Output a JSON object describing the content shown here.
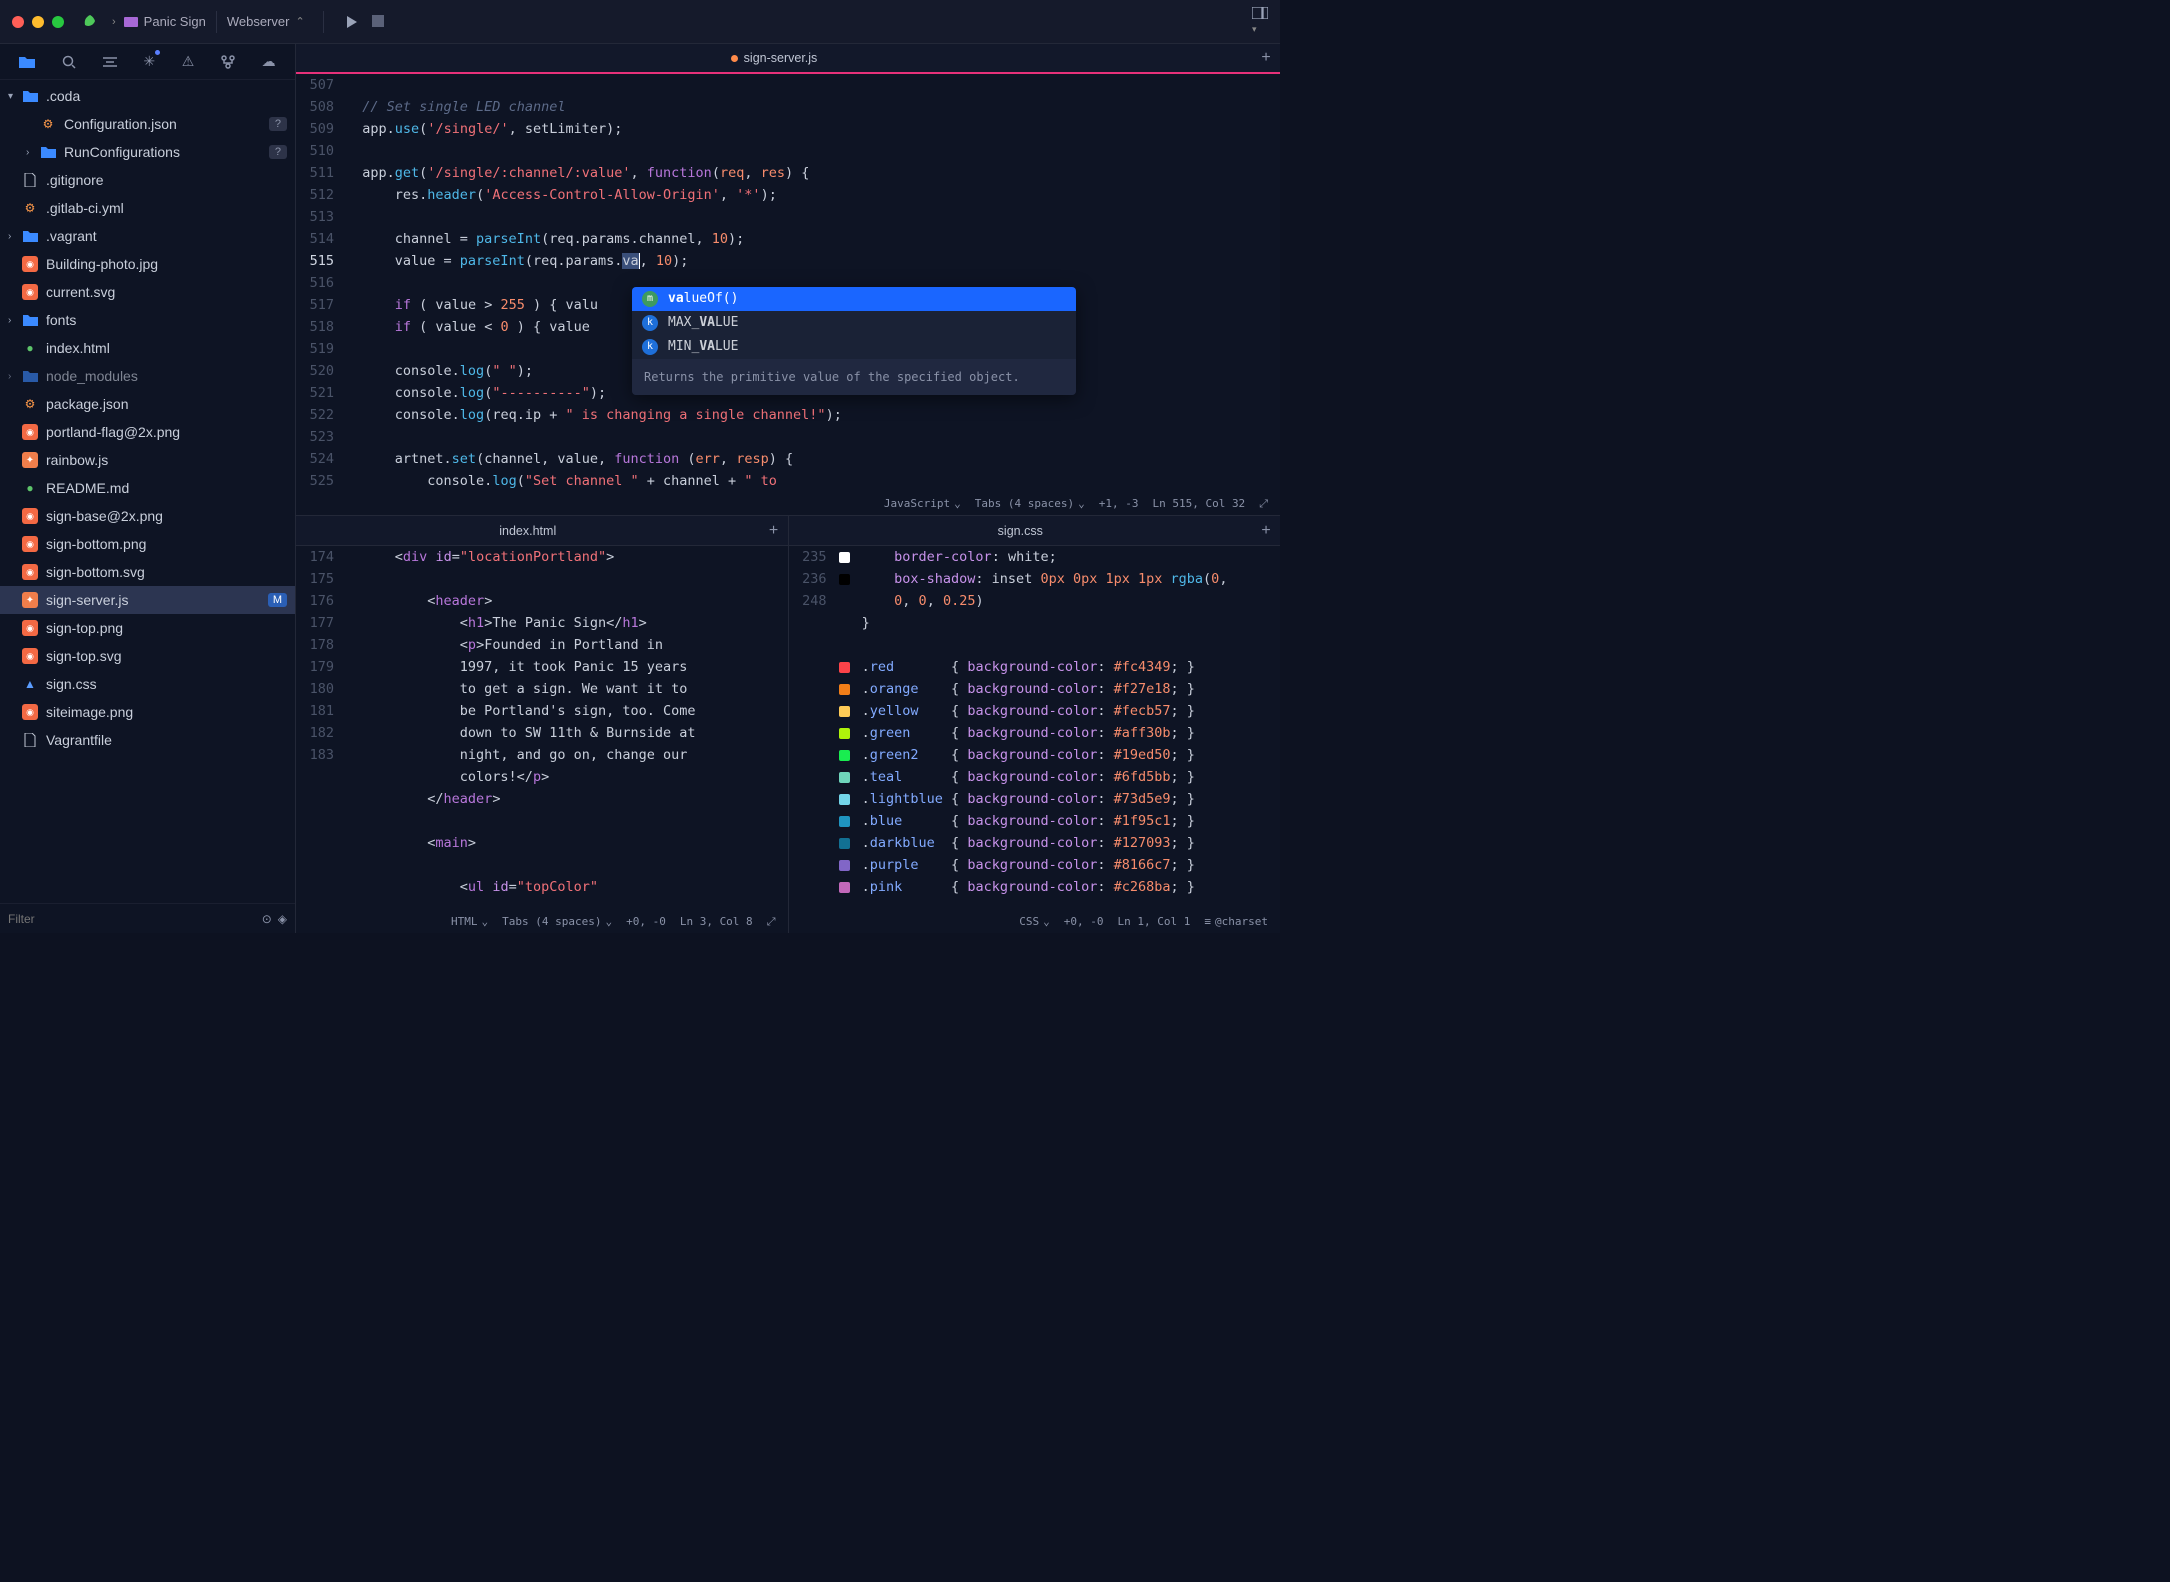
{
  "window": {
    "project": "Panic Sign",
    "target": "Webserver"
  },
  "sidebarTools": [
    "files",
    "search",
    "format",
    "snippets",
    "issues",
    "git",
    "cloud"
  ],
  "tree": [
    {
      "depth": 0,
      "type": "folder",
      "label": ".coda",
      "open": true,
      "disc": "▾"
    },
    {
      "depth": 1,
      "type": "gear",
      "label": "Configuration.json",
      "badge": "?"
    },
    {
      "depth": 1,
      "type": "folder",
      "label": "RunConfigurations",
      "disc": "›",
      "badge": "?"
    },
    {
      "depth": 0,
      "type": "file",
      "label": ".gitignore"
    },
    {
      "depth": 0,
      "type": "gear",
      "label": ".gitlab-ci.yml"
    },
    {
      "depth": 0,
      "type": "folder",
      "label": ".vagrant",
      "disc": "›"
    },
    {
      "depth": 0,
      "type": "img",
      "label": "Building-photo.jpg"
    },
    {
      "depth": 0,
      "type": "svg",
      "label": "current.svg"
    },
    {
      "depth": 0,
      "type": "folder",
      "label": "fonts",
      "disc": "›"
    },
    {
      "depth": 0,
      "type": "html",
      "label": "index.html"
    },
    {
      "depth": 0,
      "type": "folder",
      "label": "node_modules",
      "disc": "›",
      "dim": true
    },
    {
      "depth": 0,
      "type": "gear",
      "label": "package.json"
    },
    {
      "depth": 0,
      "type": "img",
      "label": "portland-flag@2x.png"
    },
    {
      "depth": 0,
      "type": "js",
      "label": "rainbow.js"
    },
    {
      "depth": 0,
      "type": "html",
      "label": "README.md"
    },
    {
      "depth": 0,
      "type": "img",
      "label": "sign-base@2x.png"
    },
    {
      "depth": 0,
      "type": "img",
      "label": "sign-bottom.png"
    },
    {
      "depth": 0,
      "type": "svg",
      "label": "sign-bottom.svg"
    },
    {
      "depth": 0,
      "type": "js",
      "label": "sign-server.js",
      "selected": true,
      "badgeM": "M"
    },
    {
      "depth": 0,
      "type": "img",
      "label": "sign-top.png"
    },
    {
      "depth": 0,
      "type": "svg",
      "label": "sign-top.svg"
    },
    {
      "depth": 0,
      "type": "css",
      "label": "sign.css"
    },
    {
      "depth": 0,
      "type": "img",
      "label": "siteimage.png"
    },
    {
      "depth": 0,
      "type": "file",
      "label": "Vagrantfile"
    }
  ],
  "filterPlaceholder": "Filter",
  "mainTab": {
    "label": "sign-server.js",
    "modified": true
  },
  "bottomTabs": {
    "left": "index.html",
    "right": "sign.css"
  },
  "mainStatus": {
    "lang": "JavaScript",
    "indent": "Tabs (4 spaces)",
    "diff": "+1, -3",
    "pos": "Ln 515, Col 32"
  },
  "htmlStatus": {
    "lang": "HTML",
    "indent": "Tabs (4 spaces)",
    "diff": "+0, -0",
    "pos": "Ln 3, Col 8"
  },
  "cssStatus": {
    "lang": "CSS",
    "diff": "+0, -0",
    "pos": "Ln 1, Col 1",
    "extra": "@charset"
  },
  "autocomplete": {
    "items": [
      {
        "kind": "m",
        "label": "valueOf()",
        "selected": true
      },
      {
        "kind": "k",
        "label": "MAX_VALUE"
      },
      {
        "kind": "k",
        "label": "MIN_VALUE"
      }
    ],
    "hint": "Returns the primitive value of the specified object."
  },
  "mainLines": {
    "start": 507,
    "highlight": 515,
    "content": [
      {
        "n": 507,
        "html": ""
      },
      {
        "n": 508,
        "html": "  <span class='cmt'>// Set single LED channel</span>"
      },
      {
        "n": 509,
        "html": "  app.<span class='fn'>use</span>(<span class='str'>'/single/'</span>, setLimiter);"
      },
      {
        "n": 510,
        "html": ""
      },
      {
        "n": 511,
        "html": "  app.<span class='fn'>get</span>(<span class='str'>'/single/:channel/:value'</span>, <span class='kw'>function</span>(<span class='param'>req</span>, <span class='param'>res</span>) {"
      },
      {
        "n": 512,
        "html": "      res.<span class='fn'>header</span>(<span class='str'>'Access-Control-Allow-Origin'</span>, <span class='str'>'*'</span>);"
      },
      {
        "n": 513,
        "html": ""
      },
      {
        "n": 514,
        "html": "      channel = <span class='fn'>parseInt</span>(req.params.channel, <span class='num'>10</span>);"
      },
      {
        "n": 515,
        "html": "      value = <span class='fn'>parseInt</span>(req.params.<span class='cursor-sel'>va</span><span style='border-left:1px solid #fff;'></span>, <span class='num'>10</span>);",
        "mark": true
      },
      {
        "n": 516,
        "html": ""
      },
      {
        "n": 517,
        "html": "      <span class='kw'>if</span> ( value &gt; <span class='num'>255</span> ) { valu"
      },
      {
        "n": 518,
        "html": "      <span class='kw'>if</span> ( value &lt; <span class='num'>0</span> ) { value"
      },
      {
        "n": 519,
        "html": ""
      },
      {
        "n": 520,
        "html": "      console.<span class='fn'>log</span>(<span class='str'>\" \"</span>);"
      },
      {
        "n": 521,
        "html": "      console.<span class='fn'>log</span>(<span class='str'>\"----------\"</span>);"
      },
      {
        "n": 522,
        "html": "      console.<span class='fn'>log</span>(req.ip + <span class='str'>\" is changing a single channel!\"</span>);"
      },
      {
        "n": 523,
        "html": ""
      },
      {
        "n": 524,
        "html": "      artnet.<span class='fn'>set</span>(channel, value, <span class='kw'>function</span> (<span class='param'>err</span>, <span class='param'>resp</span>) {"
      },
      {
        "n": 525,
        "html": "          console.<span class='fn'>log</span>(<span class='str'>\"Set channel \"</span> + channel + <span class='str'>\" to</span>"
      }
    ]
  },
  "htmlLines": [
    {
      "n": 174,
      "html": "      &lt;<span class='kw'>div</span> <span class='prop'>id</span>=<span class='str'>\"locationPortland\"</span>&gt;"
    },
    {
      "n": 175,
      "html": ""
    },
    {
      "n": 176,
      "html": "          &lt;<span class='kw'>header</span>&gt;"
    },
    {
      "n": 177,
      "html": "              &lt;<span class='kw'>h1</span>&gt;The Panic Sign&lt;/<span class='kw'>h1</span>&gt;"
    },
    {
      "n": 178,
      "html": "              &lt;<span class='kw'>p</span>&gt;Founded in Portland in"
    },
    {
      "n": "",
      "html": "              1997, it took Panic 15 years"
    },
    {
      "n": "",
      "html": "              to get a sign. We want it to"
    },
    {
      "n": "",
      "html": "              be Portland's sign, too. Come"
    },
    {
      "n": "",
      "html": "              down to SW 11th &amp; Burnside at"
    },
    {
      "n": "",
      "html": "              night, and go on, change our"
    },
    {
      "n": "",
      "html": "              colors!&lt;/<span class='kw'>p</span>&gt;"
    },
    {
      "n": 179,
      "html": "          &lt;/<span class='kw'>header</span>&gt;"
    },
    {
      "n": 180,
      "html": ""
    },
    {
      "n": 181,
      "html": "          &lt;<span class='kw'>main</span>&gt;"
    },
    {
      "n": 182,
      "html": ""
    },
    {
      "n": 183,
      "html": "              &lt;<span class='kw'>ul</span> <span class='prop'>id</span>=<span class='str'>\"topColor\"</span>"
    }
  ],
  "cssLines": [
    {
      "n": "",
      "html": "     <span class='prop'>border-color</span>: white;",
      "sw": "#fff"
    },
    {
      "n": "",
      "html": "     <span class='prop'>box-shadow</span>: inset <span class='num'>0px 0px 1px 1px</span> <span class='fn'>rgba</span>(<span class='num'>0</span>,",
      "sw": "#000"
    },
    {
      "n": "",
      "html": "     <span class='num'>0</span>, <span class='num'>0</span>, <span class='num'>0.25</span>)"
    },
    {
      "n": 235,
      "html": " }"
    },
    {
      "n": 236,
      "html": ""
    },
    {
      "n": "",
      "html": " .<span class='id'>red</span>       { <span class='prop'>background-color</span>: <span class='num'>#fc4349</span>; }",
      "sw": "#fc4349"
    },
    {
      "n": "",
      "html": " .<span class='id'>orange</span>    { <span class='prop'>background-color</span>: <span class='num'>#f27e18</span>; }",
      "sw": "#f27e18"
    },
    {
      "n": "",
      "html": " .<span class='id'>yellow</span>    { <span class='prop'>background-color</span>: <span class='num'>#fecb57</span>; }",
      "sw": "#fecb57"
    },
    {
      "n": "",
      "html": " .<span class='id'>green</span>     { <span class='prop'>background-color</span>: <span class='num'>#aff30b</span>; }",
      "sw": "#aff30b"
    },
    {
      "n": "",
      "html": " .<span class='id'>green2</span>    { <span class='prop'>background-color</span>: <span class='num'>#19ed50</span>; }",
      "sw": "#19ed50"
    },
    {
      "n": "",
      "html": " .<span class='id'>teal</span>      { <span class='prop'>background-color</span>: <span class='num'>#6fd5bb</span>; }",
      "sw": "#6fd5bb"
    },
    {
      "n": "",
      "html": " .<span class='id'>lightblue</span> { <span class='prop'>background-color</span>: <span class='num'>#73d5e9</span>; }",
      "sw": "#73d5e9"
    },
    {
      "n": "",
      "html": " .<span class='id'>blue</span>      { <span class='prop'>background-color</span>: <span class='num'>#1f95c1</span>; }",
      "sw": "#1f95c1"
    },
    {
      "n": "",
      "html": " .<span class='id'>darkblue</span>  { <span class='prop'>background-color</span>: <span class='num'>#127093</span>; }",
      "sw": "#127093"
    },
    {
      "n": "",
      "html": " .<span class='id'>purple</span>    { <span class='prop'>background-color</span>: <span class='num'>#8166c7</span>; }",
      "sw": "#8166c7"
    },
    {
      "n": "",
      "html": " .<span class='id'>pink</span>      { <span class='prop'>background-color</span>: <span class='num'>#c268ba</span>; }",
      "sw": "#c268ba"
    },
    {
      "n": 248,
      "html": ""
    }
  ]
}
